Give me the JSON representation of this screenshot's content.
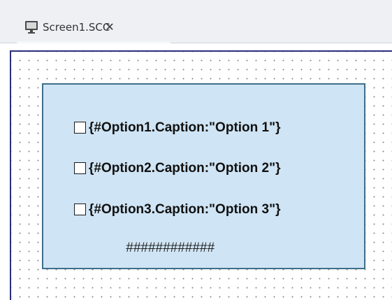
{
  "tab": {
    "icon": "monitor-icon",
    "title": "Screen1.SCC",
    "close_label": "✕"
  },
  "option_group": {
    "options": [
      {
        "caption": "{#Option1.Caption:\"Option 1\"}",
        "checked": false
      },
      {
        "caption": "{#Option2.Caption:\"Option 2\"}",
        "checked": false
      },
      {
        "caption": "{#Option3.Caption:\"Option 3\"}",
        "checked": false
      }
    ],
    "value_field": "############"
  },
  "colors": {
    "group_background": "#cfe4f4",
    "group_border": "#3e6f8a",
    "canvas_border": "#2b2f7a"
  }
}
